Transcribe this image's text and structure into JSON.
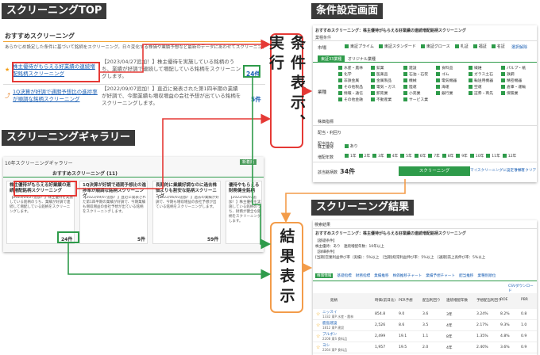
{
  "labels": {
    "top": "スクリーニングTOP",
    "gallery": "スクリーニングギャラリー",
    "conditions": "条件設定画面",
    "results": "スクリーニング結果"
  },
  "steps": {
    "execute": "条件表示、実行",
    "result_display": "結果表示"
  },
  "top_panel": {
    "heading": "おすすめスクリーニング",
    "intro": "あらかじめ設定した条件に基づいて銘柄をスクリーニング。日々変化する株価や業績予想など最新のデータにあわせてスクリーニング結果を更新します。",
    "item1_title": "株主優待がもらえる好業績の連続増配銘柄スクリーニング",
    "item1_desc": "【2023/04/27追加！】株主優待を実施している銘柄のうち、業績が好調で連続して増配している銘柄をスクリーニングします。",
    "item1_count": "24件",
    "item2_title": "1Q決算が好調で通期予想比の進捗率が順調な銘柄スクリーニング",
    "item2_desc": "【2022/09/07追加！】直近に発表された第1四半期の業績が好調で、今期業績も増収増益の会社予想が出ている銘柄をスクリーニングします。",
    "item2_count": "5件"
  },
  "gallery_panel": {
    "header": "10年スクリーニングギャラリー",
    "badge": "新着順",
    "tab": "おすすめスクリーニング (11)",
    "card1_title": "株主優待がもらえる好業績の連続増配銘柄スクリーニング",
    "card1_desc": "【2023/04/27追加！】株主優待を実施している銘柄のうち、業績が好調で連続して増配している銘柄をスクリーニングします。",
    "card1_count": "24件",
    "card2_title": "1Q決算が好調で通期予想比の進捗率が順調な銘柄スクリーニング",
    "card2_desc": "【2022/09/07追加！】直近に発表された第1四半期の業績が好調で、今期業績も増収増益の会社予想が出ている銘柄をスクリーニングします。",
    "card2_count": "5件",
    "card3_title": "長期的に業績好調なのに過去株価よりも割安な銘柄スクリーニング",
    "card3_desc": "【2022/06/03追加！】過去の業績が好調で、今期も増収増益の会社予想が出ている銘柄をスクリーニングします。",
    "card3_count": "59件",
    "card4_title": "優待やもらえる財務健全銘柄",
    "card4_desc": "【2022/06/03追加！】株主優待を実施している銘柄のうち、財務が健全な銘柄をスクリーニングします。"
  },
  "conditions_panel": {
    "title": "おすすめスクリーニング：株主優待がもらえる好業績の連続増配銘柄スクリーニング",
    "section": "業種条件",
    "market_label": "市場",
    "markets": [
      "東証プライム",
      "東証スタンダード",
      "東証グロース",
      "札証",
      "福証",
      "名証"
    ],
    "market_select": "選択解除",
    "tab1": "東証33業種",
    "tab2": "オリジナル業種",
    "industry_label": "業種",
    "industries": [
      "水産・農林",
      "鉱業",
      "建設",
      "食料品",
      "繊維",
      "パルプ・紙",
      "化学",
      "医薬品",
      "石油・石炭",
      "ゴム",
      "ガラス土石",
      "鉄鋼",
      "非鉄金属",
      "金属製品",
      "機械",
      "電気機器",
      "輸送用機器",
      "精密機器",
      "その他製品",
      "電気・ガス",
      "陸運",
      "海運",
      "空運",
      "倉庫・運輸",
      "情報・通信",
      "卸売業",
      "小売業",
      "銀行業",
      "証券・商先",
      "保険業",
      "その他金融",
      "不動産業",
      "サービス業"
    ],
    "row_price": "株価指標",
    "row_dividend": "配当・利回り",
    "row_payout": "配当性向",
    "row_yutai": "株主優待",
    "row_yutai_value": "あり",
    "row_growth": "増配年数",
    "year_options": [
      "1年",
      "2年",
      "3年",
      "4年",
      "5年",
      "6年",
      "7年",
      "8年",
      "9年",
      "10年",
      "11年",
      "12年"
    ],
    "count_label": "該当銘柄数",
    "count_value": "34件",
    "screen_button": "スクリーニング",
    "save_button": "マイスクリーニングに設定を保存",
    "clear_button": "すべてクリア"
  },
  "results_panel": {
    "header": "検索結果",
    "title": "おすすめスクリーニング：株主優待がもらえる好業績の連続増配銘柄スクリーニング",
    "cond_heading": "【基礎条件】",
    "cond_basic": "株主優待：あり　連続増配年数：10年以上",
    "cond_detail_heading": "【詳細条件】",
    "cond_detail": "[当期]営業利益伸び率（実績）：5%以上　[当期]経常利益伸び率：5%以上　[通期]売上高伸び率：5%以上",
    "tabs": [
      "株価情報",
      "基礎指標",
      "財務指標",
      "業績推移",
      "株価推移チャート",
      "業績予想チャート",
      "配当推移",
      "業種別順位"
    ],
    "download": "CSVダウンロード",
    "columns": [
      "銘柄",
      "時価(前日比)",
      "PER予想",
      "配当利回り",
      "連続増配年数",
      "予想配当利回り",
      "ROE",
      "PBR"
    ],
    "rows": [
      {
        "name": "ニッスイ",
        "code": "1332 東P 水産・農林",
        "price": "854.8",
        "per": "9.0",
        "yield": "3.6",
        "years": "3年",
        "div": "3.24%",
        "roe": "8.2%",
        "pbr": "0.8"
      },
      {
        "name": "鹿島建設",
        "code": "1812 東P 建設",
        "price": "2,526",
        "per": "8.6",
        "yield": "3.5",
        "years": "4年",
        "div": "2.17%",
        "roe": "9.3%",
        "pbr": "1.0"
      },
      {
        "name": "ブルボン",
        "code": "2208 東S 食料品",
        "price": "2,499",
        "per": "19.1",
        "yield": "1.1",
        "years": "8年",
        "div": "1.35%",
        "roe": "4.8%",
        "pbr": "0.9"
      },
      {
        "name": "ヨシ",
        "code": "2264 東P 食料品",
        "price": "1,957",
        "per": "19.5",
        "yield": "2.0",
        "years": "4年",
        "div": "2.40%",
        "roe": "3.6%",
        "pbr": "0.9"
      }
    ]
  },
  "colors": {
    "red": "#e53935",
    "green": "#2e9b4a",
    "orange": "#f39c4a",
    "label_bg": "#3a3a3a",
    "link_blue": "#1a5fb4"
  }
}
